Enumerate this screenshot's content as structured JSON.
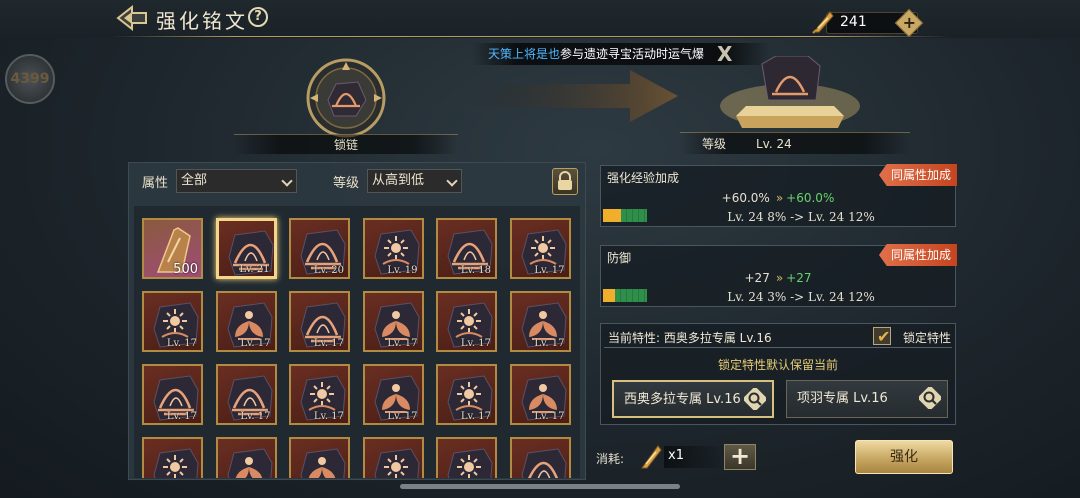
{
  "header": {
    "title": "强化铭文",
    "help_label": "?",
    "currency_value": "241",
    "currency_add": "+"
  },
  "side": {
    "float_label": "4399"
  },
  "notice": {
    "name": "天策上将是也",
    "message": "参与遗迹寻宝活动时运气爆",
    "close": "X"
  },
  "showcase": {
    "source_label": "锁链",
    "target_level_label": "等级",
    "target_level_value": "Lv. 24"
  },
  "filters": {
    "attr_label": "属性",
    "attr_value": "全部",
    "level_label": "等级",
    "level_value": "从高到低"
  },
  "grid": {
    "items": [
      {
        "kind": "material",
        "qty": "500"
      },
      {
        "kind": "flame",
        "lv": "Lv. 21",
        "selected": true
      },
      {
        "kind": "flame",
        "lv": "Lv. 20"
      },
      {
        "kind": "sun",
        "lv": "Lv. 19"
      },
      {
        "kind": "flame",
        "lv": "Lv. 18"
      },
      {
        "kind": "sun",
        "lv": "Lv. 17"
      },
      {
        "kind": "sun",
        "lv": "Lv. 17"
      },
      {
        "kind": "lotus",
        "lv": "Lv. 17"
      },
      {
        "kind": "flame",
        "lv": "Lv. 17"
      },
      {
        "kind": "lotus",
        "lv": "Lv. 17"
      },
      {
        "kind": "sun",
        "lv": "Lv. 17"
      },
      {
        "kind": "lotus",
        "lv": "Lv. 17"
      },
      {
        "kind": "flame",
        "lv": "Lv. 17"
      },
      {
        "kind": "flame",
        "lv": "Lv. 17"
      },
      {
        "kind": "sun",
        "lv": "Lv. 17"
      },
      {
        "kind": "lotus",
        "lv": "Lv. 17"
      },
      {
        "kind": "sun",
        "lv": "Lv. 17"
      },
      {
        "kind": "lotus",
        "lv": "Lv. 17"
      },
      {
        "kind": "sun",
        "lv": ""
      },
      {
        "kind": "lotus",
        "lv": ""
      },
      {
        "kind": "lotus",
        "lv": ""
      },
      {
        "kind": "sun",
        "lv": ""
      },
      {
        "kind": "sun",
        "lv": ""
      },
      {
        "kind": "flame",
        "lv": ""
      }
    ]
  },
  "stats": [
    {
      "title": "强化经验加成",
      "tag": "同属性加成",
      "old": "+60.0%",
      "new": "+60.0%",
      "lv_text": "Lv. 24  8%  ->  Lv. 24  12%",
      "bar_old": 0.08,
      "bar_new": 0.12
    },
    {
      "title": "防御",
      "tag": "同属性加成",
      "old": "+27",
      "new": "+27",
      "lv_text": "Lv. 24  3%  ->  Lv. 24  12%",
      "bar_old": 0.03,
      "bar_new": 0.12
    }
  ],
  "trait": {
    "current": "当前特性: 西奥多拉专属 Lv.16",
    "lock_label": "锁定特性",
    "locked": true,
    "note": "锁定特性默认保留当前",
    "options": [
      {
        "label": "西奥多拉专属 Lv.16",
        "selected": true
      },
      {
        "label": "项羽专属 Lv.16",
        "selected": false
      }
    ]
  },
  "cost": {
    "label": "消耗:",
    "qty": "x1",
    "add": "+"
  },
  "enhance_button": "强化",
  "colors": {
    "accent_gold": "#c9a866",
    "tag_orange": "#d8552e",
    "new_value_green": "#67d36a",
    "notice_name_blue": "#4fb7ff"
  }
}
